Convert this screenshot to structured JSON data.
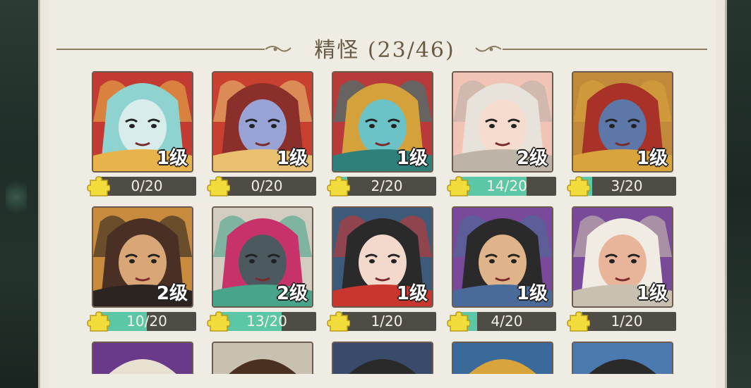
{
  "title": "精怪 (23/46)",
  "colors": {
    "panel": "#efece4",
    "title_text": "#6b5a44",
    "bar_bg": "#4f4b45",
    "bar_fill": "#5bc7a6",
    "piece": "#f2dc3c"
  },
  "cards": [
    {
      "level": "1级",
      "progress": "0/20",
      "fill": 0.0,
      "bg": "#c23a32",
      "skin": "#d9ecec",
      "hair": "#8fd3d0",
      "accent": "#e8b34a"
    },
    {
      "level": "1级",
      "progress": "0/20",
      "fill": 0.0,
      "bg": "#c84030",
      "skin": "#9aa3d6",
      "hair": "#8b2f2a",
      "accent": "#e8c070"
    },
    {
      "level": "1级",
      "progress": "2/20",
      "fill": 0.1,
      "bg": "#b83a3a",
      "skin": "#6bc3c8",
      "hair": "#d4a13a",
      "accent": "#2f7f7a"
    },
    {
      "level": "2级",
      "progress": "14/20",
      "fill": 0.7,
      "bg": "#f2c4b8",
      "skin": "#f5dccf",
      "hair": "#e8e3da",
      "accent": "#bdb3a6"
    },
    {
      "level": "1级",
      "progress": "3/20",
      "fill": 0.15,
      "bg": "#c08a3a",
      "skin": "#5d78a8",
      "hair": "#a83228",
      "accent": "#d9a43c"
    },
    {
      "level": "2级",
      "progress": "10/20",
      "fill": 0.5,
      "bg": "#c98b3d",
      "skin": "#d9a777",
      "hair": "#4a3024",
      "accent": "#2b2420"
    },
    {
      "level": "2级",
      "progress": "13/20",
      "fill": 0.65,
      "bg": "#d2cdc0",
      "skin": "#4c5a60",
      "hair": "#c8326a",
      "accent": "#48a48a"
    },
    {
      "level": "1级",
      "progress": "1/20",
      "fill": 0.05,
      "bg": "#3e5a7a",
      "skin": "#f2d9cc",
      "hair": "#2a2a2a",
      "accent": "#c8362e"
    },
    {
      "level": "1级",
      "progress": "4/20",
      "fill": 0.2,
      "bg": "#7a4a9a",
      "skin": "#e0b48a",
      "hair": "#2a2a2a",
      "accent": "#4a6a9a"
    },
    {
      "level": "1级",
      "progress": "1/20",
      "fill": 0.05,
      "bg": "#7a4a9a",
      "skin": "#e8b49a",
      "hair": "#f0ece4",
      "accent": "#c8c0b0"
    }
  ],
  "partial_cards": [
    {
      "bg": "#6a3a8a",
      "accent": "#e8e0d0"
    },
    {
      "bg": "#c8c0b0",
      "accent": "#4a3020"
    },
    {
      "bg": "#3a4a6a",
      "accent": "#2a2a2a"
    },
    {
      "bg": "#3a6a9a",
      "accent": "#d9a43c"
    },
    {
      "bg": "#4a7ab0",
      "accent": "#2a2a2a"
    }
  ]
}
